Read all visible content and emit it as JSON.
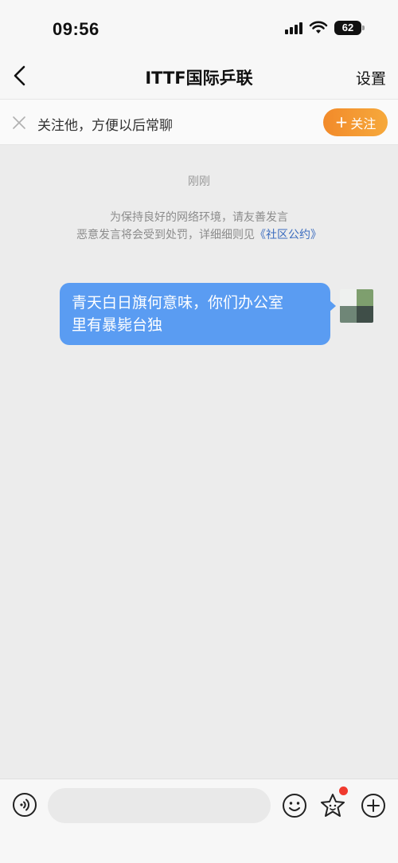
{
  "status_bar": {
    "time": "09:56",
    "battery": "62"
  },
  "nav": {
    "title": "ITTF国际乒联",
    "settings_label": "设置"
  },
  "follow_banner": {
    "prompt": "关注他，方便以后常聊",
    "follow_label": "关注"
  },
  "chat": {
    "timestamp": "刚刚",
    "notice_line1": "为保持良好的网络环境，请友善发言",
    "notice_line2": "恶意发言将会受到处罚，详细细则见",
    "notice_link": "《社区公约》",
    "messages": [
      {
        "sender": "self",
        "text_line1": "青天白日旗何意味，你们办公室",
        "text_line2": "里有暴毙台独"
      }
    ]
  },
  "input_bar": {
    "placeholder": ""
  },
  "colors": {
    "accent_orange": "#f28a2a",
    "bubble_blue": "#5a9cf2",
    "link_blue": "#3b6cbf",
    "badge_red": "#f03a2e"
  },
  "icons": [
    "back-icon",
    "close-icon",
    "plus-icon",
    "voice-icon",
    "emoji-icon",
    "sticker-icon",
    "add-icon",
    "signal-icon",
    "wifi-icon",
    "battery-icon"
  ]
}
